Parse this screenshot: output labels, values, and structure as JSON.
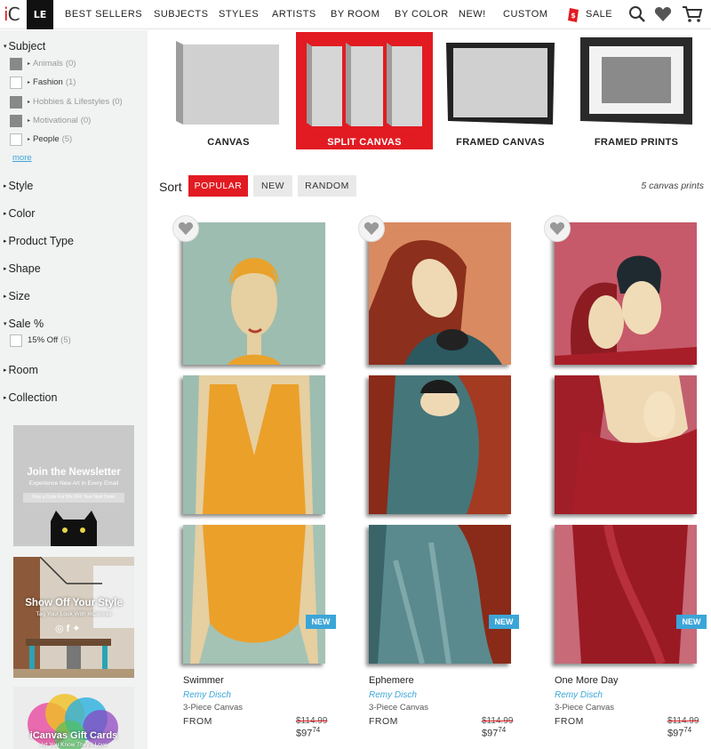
{
  "nav": {
    "logo_i": "i",
    "logo_c": "C",
    "locale_tab": "LE",
    "items": [
      "BEST SELLERS",
      "SUBJECTS",
      "STYLES",
      "ARTISTS",
      "BY ROOM",
      "BY COLOR",
      "NEW!",
      "CUSTOM"
    ],
    "sale_label": "SALE",
    "icons": [
      "search-icon",
      "heart-icon",
      "cart-icon"
    ]
  },
  "sidebar": {
    "subject_heading": "Subject",
    "subjects": [
      {
        "label": "Animals",
        "count": "(0)",
        "checked": true
      },
      {
        "label": "Fashion",
        "count": "(1)",
        "checked": false
      },
      {
        "label": "Hobbies & Lifestyles",
        "count": "(0)",
        "checked": true
      },
      {
        "label": "Motivational",
        "count": "(0)",
        "checked": true
      },
      {
        "label": "People",
        "count": "(5)",
        "checked": false
      }
    ],
    "more_link": "more",
    "filters": [
      "Style",
      "Color",
      "Product Type",
      "Shape",
      "Size",
      "Sale %",
      "Room",
      "Collection"
    ],
    "sale_option": {
      "label": "15% Off",
      "count": "(5)"
    },
    "promos": {
      "newsletter_title": "Join the Newsletter",
      "newsletter_sub": "Experience New Art in Every Email",
      "newsletter_code": "Plus a Code For 5% OFF Your Next Order",
      "style_title": "Show Off Your Style",
      "style_sub": "Tag Your Look With #iCanvas",
      "gift_title": "iCanvas Gift Cards",
      "gift_sub": "Art You Know They'll Love"
    }
  },
  "formats": [
    {
      "label": "CANVAS",
      "active": false
    },
    {
      "label": "SPLIT CANVAS",
      "active": true
    },
    {
      "label": "FRAMED CANVAS",
      "active": false
    },
    {
      "label": "FRAMED PRINTS",
      "active": false
    }
  ],
  "sort": {
    "label": "Sort",
    "options": [
      "POPULAR",
      "NEW",
      "RANDOM"
    ],
    "active": "POPULAR",
    "result_count": "5 canvas prints"
  },
  "products": [
    {
      "title": "Swimmer",
      "artist": "Remy Disch",
      "type": "3-Piece Canvas",
      "from": "FROM",
      "old_price": "$114.99",
      "price_main": "$97",
      "price_cents": "74",
      "badge": "NEW"
    },
    {
      "title": "Ephemere",
      "artist": "Remy Disch",
      "type": "3-Piece Canvas",
      "from": "FROM",
      "old_price": "$114.99",
      "price_main": "$97",
      "price_cents": "74",
      "badge": "NEW"
    },
    {
      "title": "One More Day",
      "artist": "Remy Disch",
      "type": "3-Piece Canvas",
      "from": "FROM",
      "old_price": "$114.99",
      "price_main": "$97",
      "price_cents": "74",
      "badge": "NEW"
    }
  ],
  "colors": {
    "brand_red": "#e21b22",
    "link_blue": "#3ba5d8",
    "sidebar_bg": "#f1f2f2"
  }
}
